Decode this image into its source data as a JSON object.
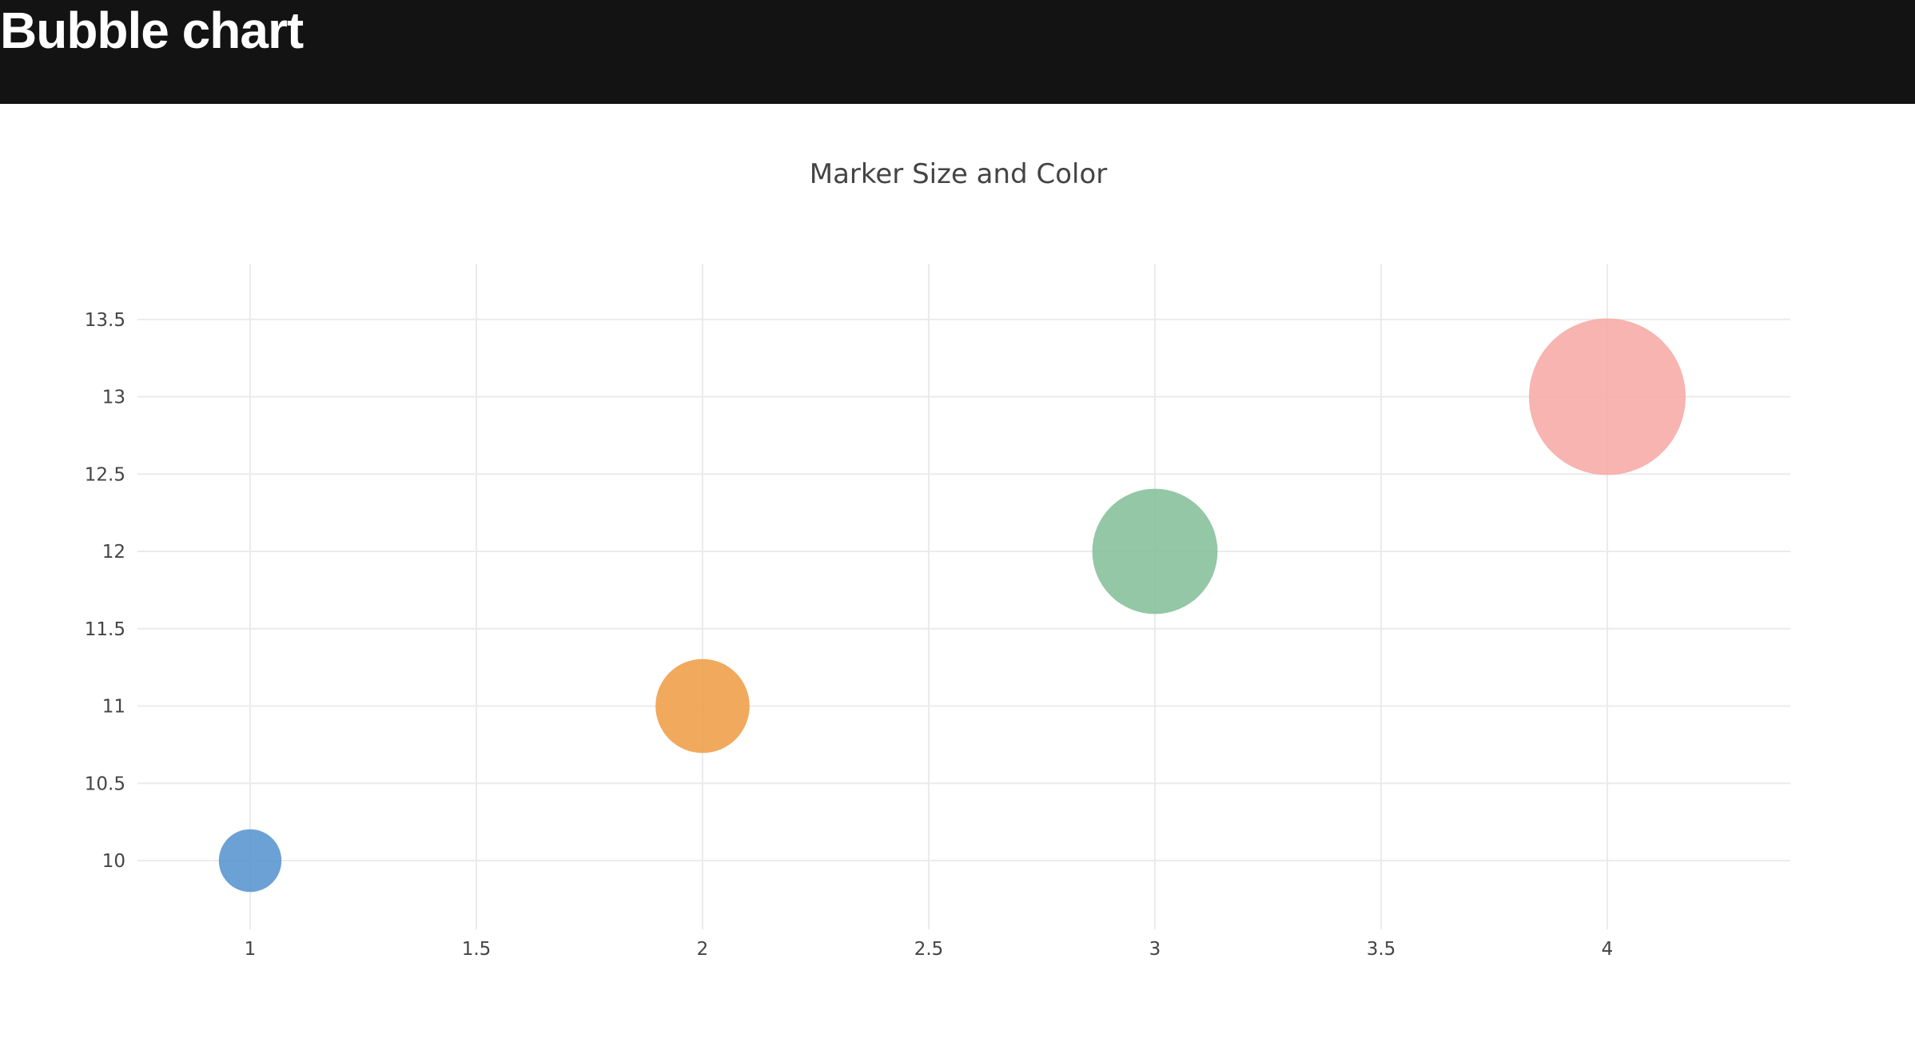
{
  "page": {
    "title": "Bubble chart"
  },
  "chart_data": {
    "type": "scatter",
    "title": "Marker Size and Color",
    "xlabel": "",
    "ylabel": "",
    "x": [
      1,
      2,
      3,
      4
    ],
    "y": [
      10,
      11,
      12,
      13
    ],
    "marker_sizes": [
      40,
      60,
      80,
      100
    ],
    "marker_colors": [
      "#5b97cf",
      "#f0a04b",
      "#88c19b",
      "#f6aca7"
    ],
    "marker_opacity": 0.9,
    "xlim": [
      0.75,
      4.4
    ],
    "ylim": [
      9.55,
      13.85
    ],
    "x_ticks": [
      1,
      1.5,
      2,
      2.5,
      3,
      3.5,
      4
    ],
    "x_tick_labels": [
      "1",
      "1.5",
      "2",
      "2.5",
      "3",
      "3.5",
      "4"
    ],
    "y_ticks": [
      10,
      10.5,
      11,
      11.5,
      12,
      12.5,
      13,
      13.5
    ],
    "y_tick_labels": [
      "10",
      "10.5",
      "11",
      "11.5",
      "12",
      "12.5",
      "13",
      "13.5"
    ],
    "grid": true,
    "legend": "none"
  }
}
